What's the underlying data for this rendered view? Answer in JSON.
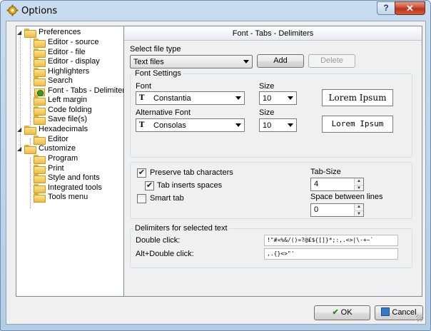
{
  "window": {
    "title": "Options",
    "help_label": "?",
    "close_label": "✕"
  },
  "tree": {
    "items": [
      {
        "label": "Preferences",
        "level": 0,
        "expanded": true
      },
      {
        "label": "Editor - source",
        "level": 1
      },
      {
        "label": "Editor - file",
        "level": 1
      },
      {
        "label": "Editor - display",
        "level": 1
      },
      {
        "label": "Highlighters",
        "level": 1
      },
      {
        "label": "Search",
        "level": 1
      },
      {
        "label": "Font - Tabs - Delimiters",
        "level": 1,
        "selected": true
      },
      {
        "label": "Left margin",
        "level": 1
      },
      {
        "label": "Code folding",
        "level": 1
      },
      {
        "label": "Save file(s)",
        "level": 1
      },
      {
        "label": "Hexadecimals",
        "level": 0,
        "expanded": true
      },
      {
        "label": "Editor",
        "level": 1
      },
      {
        "label": "Customize",
        "level": 0,
        "expanded": true
      },
      {
        "label": "Program",
        "level": 1
      },
      {
        "label": "Print",
        "level": 1
      },
      {
        "label": "Style and fonts",
        "level": 1
      },
      {
        "label": "Integrated tools",
        "level": 1
      },
      {
        "label": "Tools menu",
        "level": 1
      }
    ]
  },
  "panel": {
    "header": "Font - Tabs - Delimiters",
    "file_type_label": "Select file type",
    "file_type_value": "Text files",
    "add_label": "Add",
    "delete_label": "Delete",
    "font_settings": {
      "title": "Font Settings",
      "font_label": "Font",
      "font_value": "Constantia",
      "size_label": "Size",
      "size_value": "10",
      "preview_text": "Lorem Ipsum",
      "alt_font_label": "Alternative Font",
      "alt_font_value": "Consolas",
      "alt_size_label": "Size",
      "alt_size_value": "10",
      "alt_preview_text": "Lorem Ipsum",
      "font_icon": "TrueType-font-icon"
    },
    "tabs": {
      "preserve_label": "Preserve tab characters",
      "preserve_checked": true,
      "inserts_spaces_label": "Tab inserts spaces",
      "inserts_spaces_checked": true,
      "smart_tab_label": "Smart tab",
      "smart_tab_checked": false,
      "tab_size_label": "Tab-Size",
      "tab_size_value": "4",
      "line_space_label": "Space between lines",
      "line_space_value": "0"
    },
    "delimiters": {
      "title": "Delimiters for selected text",
      "double_click_label": "Double click:",
      "double_click_value": "!\"#¤%&/()=?@£${[]}*;:,.<>|\\-+~`",
      "alt_double_click_label": "Alt+Double click:",
      "alt_double_click_value": ",.{}<>\"'"
    }
  },
  "footer": {
    "ok_label": "OK",
    "cancel_label": "Cancel"
  },
  "colors": {
    "titlebar": "#c9dcef",
    "close": "#c6452c",
    "ok_check": "#2b8a1a"
  }
}
